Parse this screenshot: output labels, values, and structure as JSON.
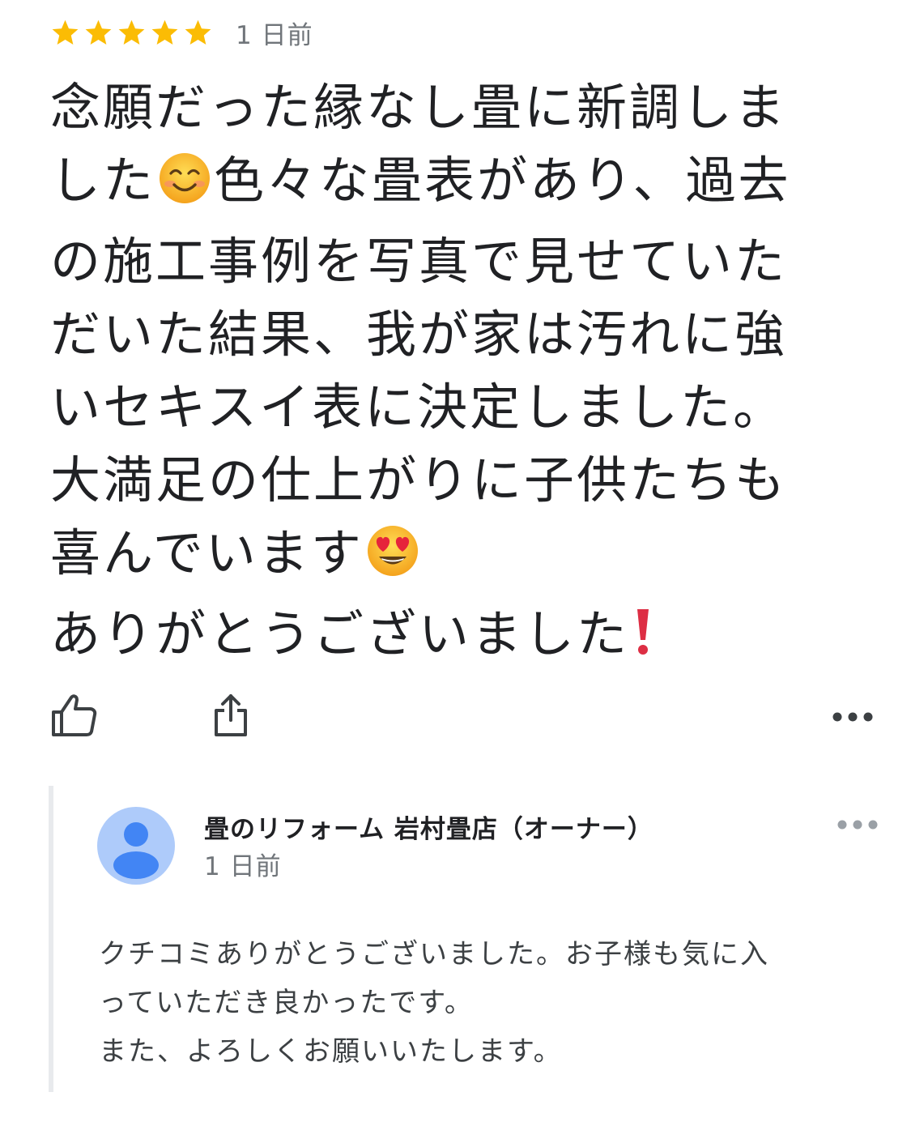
{
  "review": {
    "rating": 5,
    "max_rating": 5,
    "date": "1 日前",
    "lines": [
      "念願だった縁なし畳に新調しま",
      "した",
      "色々な畳表があり、過去",
      "の施工事例を写真で見せていた",
      "だいた結果、我が家は汚れに強",
      "いセキスイ表に決定しました。",
      "大満足の仕上がりに子供たちも",
      "喜んでいます",
      "ありがとうございました"
    ],
    "emoji": {
      "smile": "smiling-face-emoji",
      "heart_eyes": "heart-eyes-emoji",
      "exclamation": "red-exclamation-emoji"
    },
    "star_color": "#fbbc04"
  },
  "actions": {
    "like_icon": "thumbs-up-icon",
    "share_icon": "share-icon",
    "more_icon": "more-options-icon"
  },
  "owner_reply": {
    "name": "畳のリフォーム 岩村畳店（オーナー）",
    "date": "1 日前",
    "avatar_icon": "person-avatar-icon",
    "avatar_bg": "#aecbfa",
    "avatar_fg": "#4285f4",
    "more_icon": "more-options-icon",
    "lines": [
      "クチコミありがとうございました。お子様も気に入",
      "っていただき良かったです。",
      "また、よろしくお願いいたします。"
    ]
  }
}
